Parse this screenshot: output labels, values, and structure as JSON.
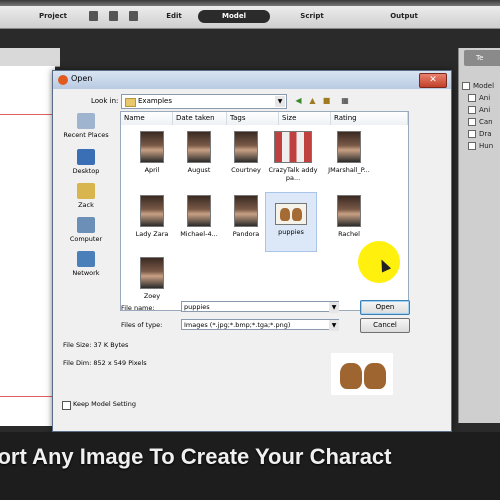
{
  "app": {
    "menu_tabs": [
      "Project",
      "Edit",
      "Model",
      "Script",
      "Output"
    ],
    "active_tab": "Model",
    "right_panel": {
      "header": "Te",
      "tree_root": "Model",
      "tree_items": [
        "Ani",
        "Ani",
        "Can",
        "Dra",
        "Hun"
      ]
    }
  },
  "dialog": {
    "title": "Open",
    "close_glyph": "✕",
    "look_in_label": "Look in:",
    "look_in_value": "Examples",
    "places": [
      "Recent Places",
      "Desktop",
      "Zack",
      "Computer",
      "Network"
    ],
    "columns": [
      "Name",
      "Date taken",
      "Tags",
      "Size",
      "Rating"
    ],
    "files": [
      {
        "name": "April",
        "kind": "portrait"
      },
      {
        "name": "August",
        "kind": "portrait"
      },
      {
        "name": "Courtney",
        "kind": "portrait"
      },
      {
        "name": "CrazyTalk addy pa...",
        "kind": "group"
      },
      {
        "name": "JMarshall_P...",
        "kind": "portrait"
      },
      {
        "name": "Lady Zara",
        "kind": "portrait"
      },
      {
        "name": "Michael-4...",
        "kind": "portrait"
      },
      {
        "name": "Pandora",
        "kind": "portrait"
      },
      {
        "name": "puppies",
        "kind": "puppy",
        "selected": true
      },
      {
        "name": "Rachel",
        "kind": "portrait"
      },
      {
        "name": "Zoey",
        "kind": "portrait"
      }
    ],
    "file_name_label": "File name:",
    "file_name_value": "puppies",
    "file_type_label": "Files of type:",
    "file_type_value": "Images (*.jpg;*.bmp;*.tga;*.png)",
    "open_button": "Open",
    "cancel_button": "Cancel",
    "file_size": "File Size: 37 K Bytes",
    "file_dim": "File Dim: 852 x 549 Pixels",
    "keep_model_label": "Keep Model Setting",
    "combo_arrow": "▼"
  },
  "caption": "port Any Image To Create Your Charact",
  "colors": {
    "highlight": "#ffef00",
    "titlebar": "#b9cbe2",
    "selection": "#dce8f7"
  }
}
